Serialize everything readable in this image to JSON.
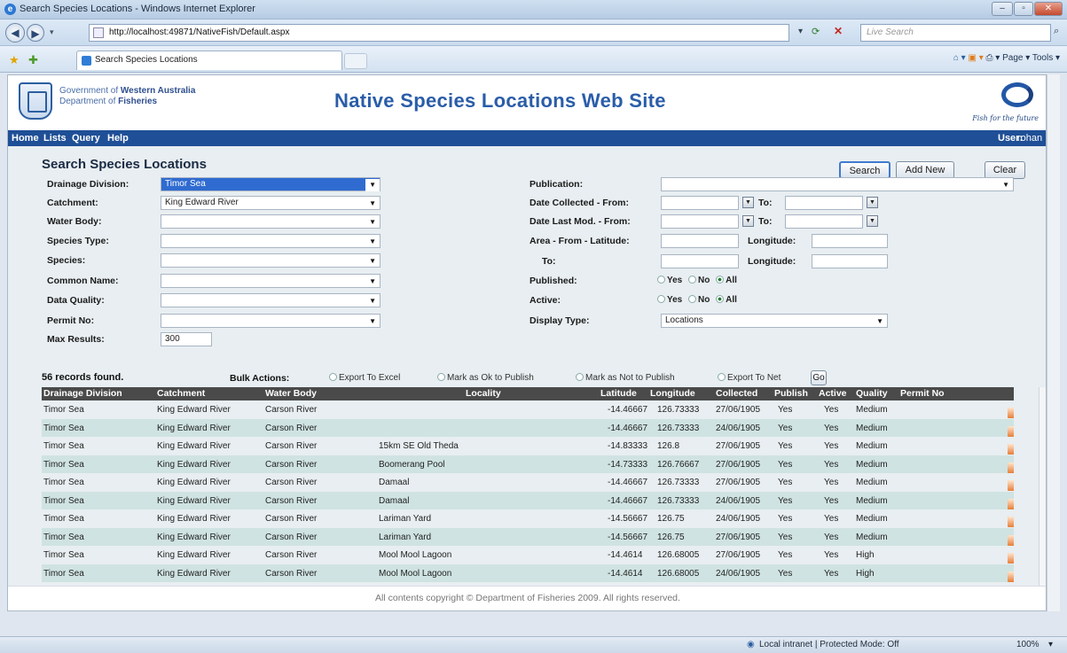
{
  "window": {
    "title": "Search Species Locations - Windows Internet Explorer",
    "url": "http://localhost:49871/NativeFish/Default.aspx",
    "live_search_placeholder": "Live Search",
    "tab_title": "Search Species Locations",
    "command_bar": "Page ▾  Tools ▾",
    "status_zone": "Local intranet | Protected Mode: Off",
    "zoom": "100%"
  },
  "header": {
    "gov_line1_prefix": "Government of ",
    "gov_line1_bold": "Western Australia",
    "gov_line2_prefix": "Department of ",
    "gov_line2_bold": "Fisheries",
    "site_title": "Native Species Locations Web Site",
    "tagline": "Fish for the future"
  },
  "nav": {
    "items": [
      "Home",
      "Lists",
      "Query",
      "Help"
    ],
    "user_label": "User:",
    "user_name": "rohan"
  },
  "form": {
    "title": "Search Species Locations",
    "buttons": {
      "search": "Search",
      "add_new": "Add New",
      "clear": "Clear"
    },
    "left_fields": [
      {
        "label": "Drainage Division:",
        "value": "Timor Sea"
      },
      {
        "label": "Catchment:",
        "value": "King Edward River"
      },
      {
        "label": "Water Body:",
        "value": ""
      },
      {
        "label": "Species Type:",
        "value": ""
      },
      {
        "label": "Species:",
        "value": ""
      },
      {
        "label": "Common Name:",
        "value": ""
      },
      {
        "label": "Data Quality:",
        "value": ""
      },
      {
        "label": "Permit No:",
        "value": ""
      }
    ],
    "max_results_label": "Max Results:",
    "max_results": "300",
    "publication_label": "Publication:",
    "publication_value": "",
    "date_collected_label": "Date Collected - From:",
    "date_last_mod_label": "Date Last Mod. - From:",
    "to_label": "To:",
    "area_label": "Area - From - Latitude:",
    "area_to_label": "To:",
    "longitude_label": "Longitude:",
    "published_label": "Published:",
    "active_label": "Active:",
    "radio_yes": "Yes",
    "radio_no": "No",
    "radio_all": "All",
    "display_type_label": "Display Type:",
    "display_type_value": "Locations"
  },
  "results": {
    "count_text": "56 records found.",
    "bulk_label": "Bulk Actions:",
    "bulk_options": [
      "Export To Excel",
      "Mark as Ok to Publish",
      "Mark as Not to Publish",
      "Export To Net"
    ],
    "go_label": "Go",
    "columns": [
      "Drainage Division",
      "Catchment",
      "Water Body",
      "Locality",
      "Latitude",
      "Longitude",
      "Collected",
      "Publish",
      "Active",
      "Quality",
      "Permit No"
    ],
    "rows": [
      [
        "Timor Sea",
        "King Edward River",
        "Carson River",
        "",
        "-14.46667",
        "126.73333",
        "27/06/1905",
        "Yes",
        "Yes",
        "Medium",
        ""
      ],
      [
        "Timor Sea",
        "King Edward River",
        "Carson River",
        "",
        "-14.46667",
        "126.73333",
        "24/06/1905",
        "Yes",
        "Yes",
        "Medium",
        ""
      ],
      [
        "Timor Sea",
        "King Edward River",
        "Carson River",
        "15km SE Old Theda",
        "-14.83333",
        "126.8",
        "27/06/1905",
        "Yes",
        "Yes",
        "Medium",
        ""
      ],
      [
        "Timor Sea",
        "King Edward River",
        "Carson River",
        "Boomerang Pool",
        "-14.73333",
        "126.76667",
        "27/06/1905",
        "Yes",
        "Yes",
        "Medium",
        ""
      ],
      [
        "Timor Sea",
        "King Edward River",
        "Carson River",
        "Damaal",
        "-14.46667",
        "126.73333",
        "27/06/1905",
        "Yes",
        "Yes",
        "Medium",
        ""
      ],
      [
        "Timor Sea",
        "King Edward River",
        "Carson River",
        "Damaal",
        "-14.46667",
        "126.73333",
        "24/06/1905",
        "Yes",
        "Yes",
        "Medium",
        ""
      ],
      [
        "Timor Sea",
        "King Edward River",
        "Carson River",
        "Lariman Yard",
        "-14.56667",
        "126.75",
        "24/06/1905",
        "Yes",
        "Yes",
        "Medium",
        ""
      ],
      [
        "Timor Sea",
        "King Edward River",
        "Carson River",
        "Lariman Yard",
        "-14.56667",
        "126.75",
        "27/06/1905",
        "Yes",
        "Yes",
        "Medium",
        ""
      ],
      [
        "Timor Sea",
        "King Edward River",
        "Carson River",
        "Mool Mool Lagoon",
        "-14.4614",
        "126.68005",
        "27/06/1905",
        "Yes",
        "Yes",
        "High",
        ""
      ],
      [
        "Timor Sea",
        "King Edward River",
        "Carson River",
        "Mool Mool Lagoon",
        "-14.4614",
        "126.68005",
        "24/06/1905",
        "Yes",
        "Yes",
        "High",
        ""
      ]
    ]
  },
  "footer": {
    "copyright": "All contents copyright © Department of Fisheries 2009. All rights reserved."
  },
  "colors": {
    "nav_bg": "#1f4f96",
    "title_blue": "#2a5da8",
    "row_alt": "#cfe3e2",
    "table_header": "#4a4a4a"
  }
}
